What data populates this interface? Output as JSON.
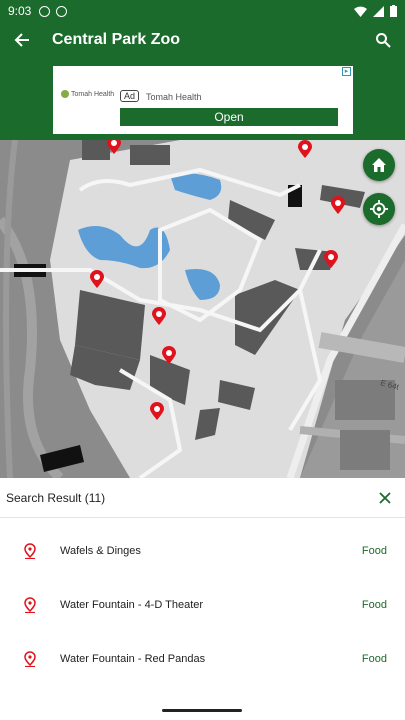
{
  "status_bar": {
    "time": "9:03"
  },
  "app_bar": {
    "title": "Central Park Zoo"
  },
  "ad": {
    "logo_text": "Tomah Health",
    "badge": "Ad",
    "advertiser": "Tomah Health",
    "cta": "Open"
  },
  "map": {
    "street_label": "E 64t"
  },
  "results": {
    "title": "Search Result (11)",
    "items": [
      {
        "name": "Wafels & Dinges",
        "category": "Food"
      },
      {
        "name": "Water Fountain - 4-D Theater",
        "category": "Food"
      },
      {
        "name": "Water Fountain - Red Pandas",
        "category": "Food"
      }
    ]
  },
  "colors": {
    "brand": "#1b6b2c",
    "pin": "#e0121b",
    "map_bg": "#8b8b8b"
  }
}
